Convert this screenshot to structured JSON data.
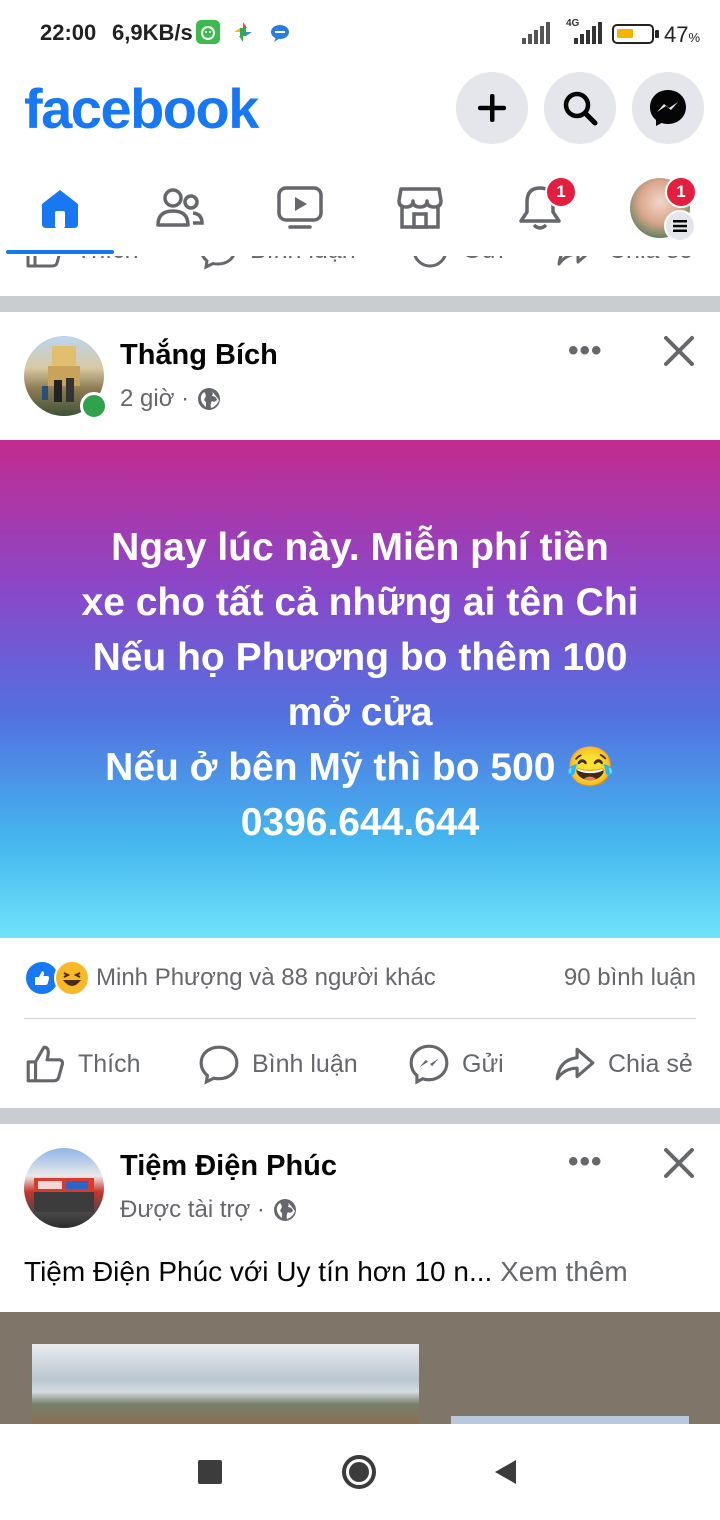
{
  "status_bar": {
    "time": "22:00",
    "speed": "6,9KB/s",
    "network": "4G",
    "battery_percent": "47",
    "battery_unit": "%",
    "battery_level": 0.47,
    "icons": [
      "app-notification-icon",
      "photos-app-icon",
      "chat-app-icon",
      "signal-icon",
      "signal-4g-icon",
      "battery-icon"
    ]
  },
  "header": {
    "logo": "facebook",
    "buttons": [
      "create-icon",
      "search-icon",
      "messenger-icon"
    ]
  },
  "tabs": {
    "items": [
      {
        "name": "home",
        "icon": "home-icon",
        "active": true
      },
      {
        "name": "friends",
        "icon": "friends-icon"
      },
      {
        "name": "watch",
        "icon": "video-icon"
      },
      {
        "name": "marketplace",
        "icon": "marketplace-icon"
      },
      {
        "name": "notifications",
        "icon": "bell-icon",
        "badge": "1"
      },
      {
        "name": "menu",
        "icon": "profile-avatar",
        "badge": "1"
      }
    ],
    "accent": "#1877f2"
  },
  "post1": {
    "author": "Thắng Bích",
    "time": "2 giờ ·",
    "privacy_icon": "globe-icon",
    "body": "Ngay lúc này. Miễn phí tiền\nxe cho tất cả những ai tên Chi\nNếu họ Phương bo thêm 100\nmở cửa\nNếu ở bên Mỹ thì bo 500 😂\n0396.644.644",
    "reactions_text": "Minh Phượng và 88 người khác",
    "comments_count": "90 bình luận",
    "actions": {
      "like": "Thích",
      "comment": "Bình luận",
      "send": "Gửi",
      "share": "Chia sẻ"
    }
  },
  "previous_post_actions": {
    "like": "Thích",
    "comment": "Bình luận",
    "send": "Gửi",
    "share": "Chia sẻ"
  },
  "post2": {
    "author": "Tiệm Điện Phúc",
    "meta": "Được tài trợ ·",
    "privacy_icon": "globe-icon",
    "text": "Tiệm Điện Phúc với Uy tín hơn 10 n...",
    "see_more": "Xem thêm"
  },
  "nav_bar": {
    "buttons": [
      "recent-apps-icon",
      "home-circle-icon",
      "back-icon"
    ]
  }
}
